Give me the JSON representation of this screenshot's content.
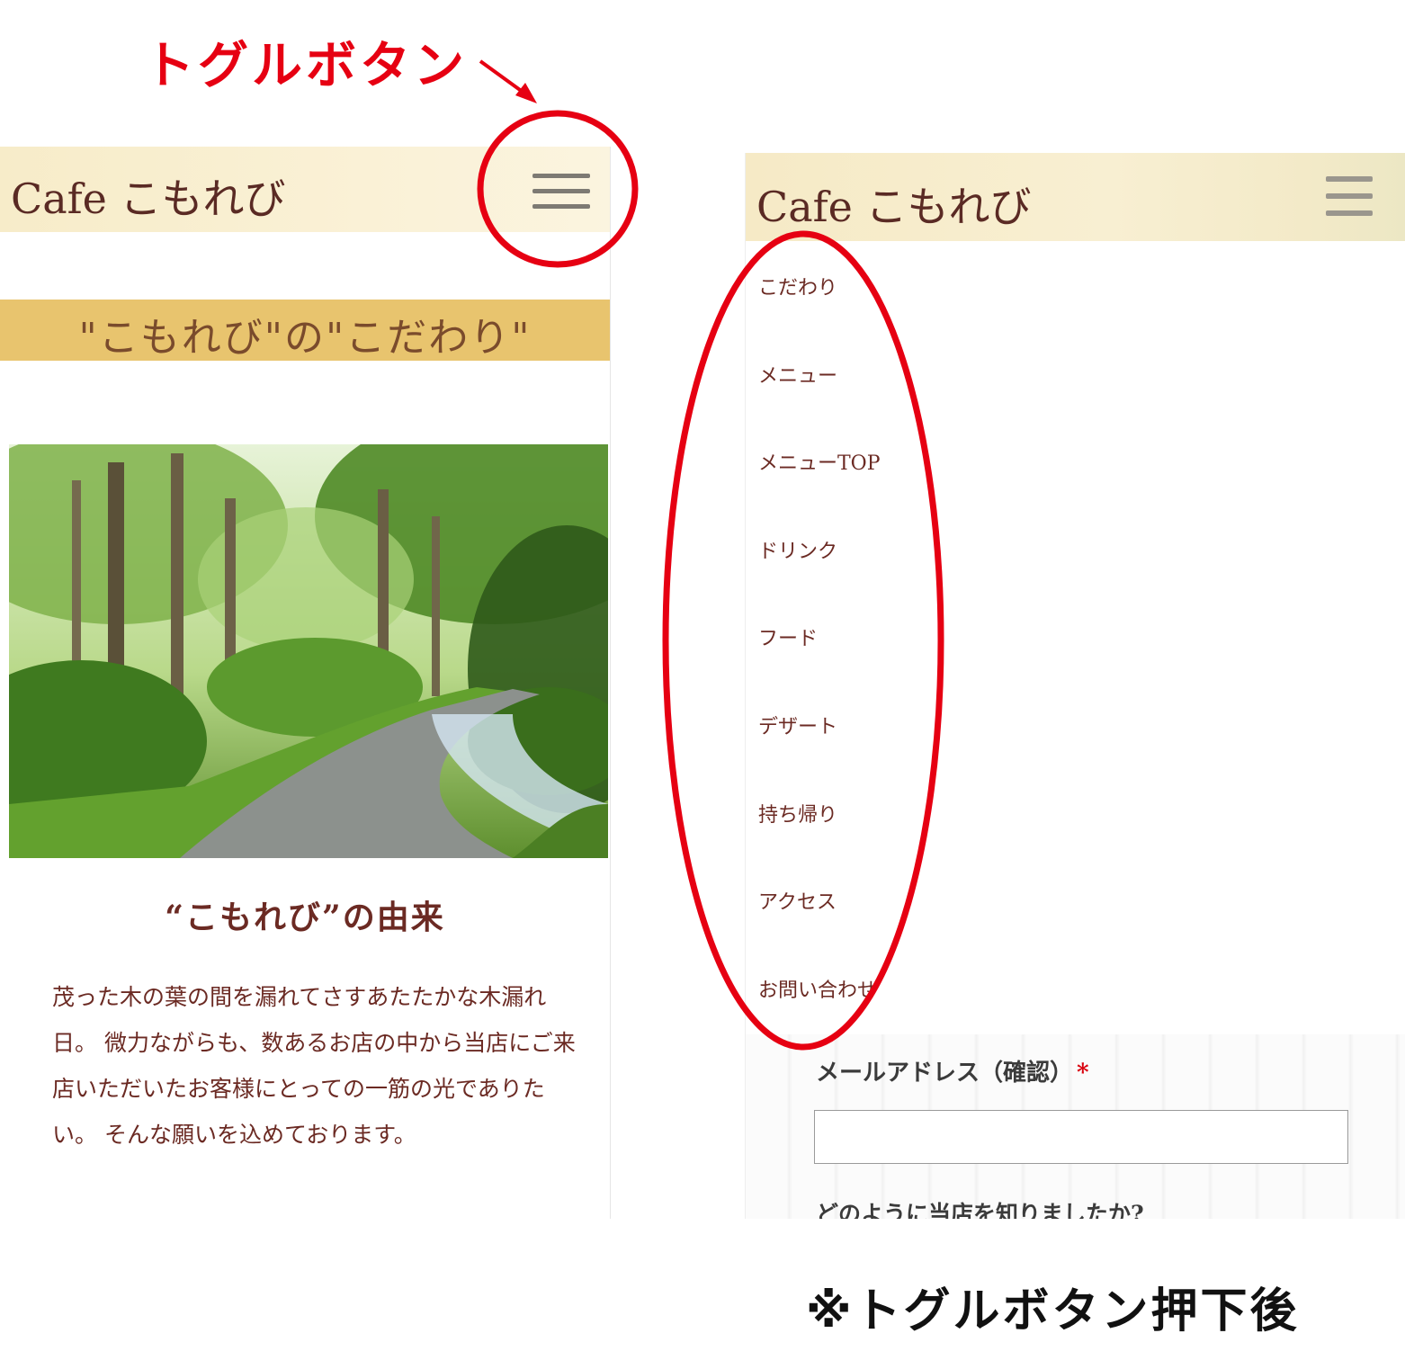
{
  "annotations": {
    "toggle_label": "トグルボタン",
    "after_label": "※トグルボタン押下後",
    "highlight_color": "#e60012"
  },
  "before_screen": {
    "site_title": "Cafe こもれび",
    "section_title": "\"こもれび\"の\"こだわり\"",
    "image_alt": "forest-path-photo",
    "origin_title": "“こもれび”の由来",
    "origin_text": "茂った木の葉の間を漏れてさすあたたかな木漏れ日。 微力ながらも、数あるお店の中から当店にご来店いただいたお客様にとっての一筋の光でありたい。 そんな願いを込めております。"
  },
  "after_screen": {
    "site_title": "Cafe こもれび",
    "nav_items": [
      {
        "label": "こだわり"
      },
      {
        "label": "メニュー"
      },
      {
        "label": "メニューTOP"
      },
      {
        "label": "ドリンク"
      },
      {
        "label": "フード"
      },
      {
        "label": "デザート"
      },
      {
        "label": "持ち帰り"
      },
      {
        "label": "アクセス"
      },
      {
        "label": "お問い合わせ"
      }
    ],
    "form": {
      "email_confirm_label": "メールアドレス（確認）",
      "required_mark": "*",
      "email_confirm_value": "",
      "question_label": "どのように当店を知りましたか?"
    }
  },
  "colors": {
    "header_bg": "#f7ecc9",
    "section_band": "#e8c46e",
    "text_brown": "#6b2a23"
  }
}
